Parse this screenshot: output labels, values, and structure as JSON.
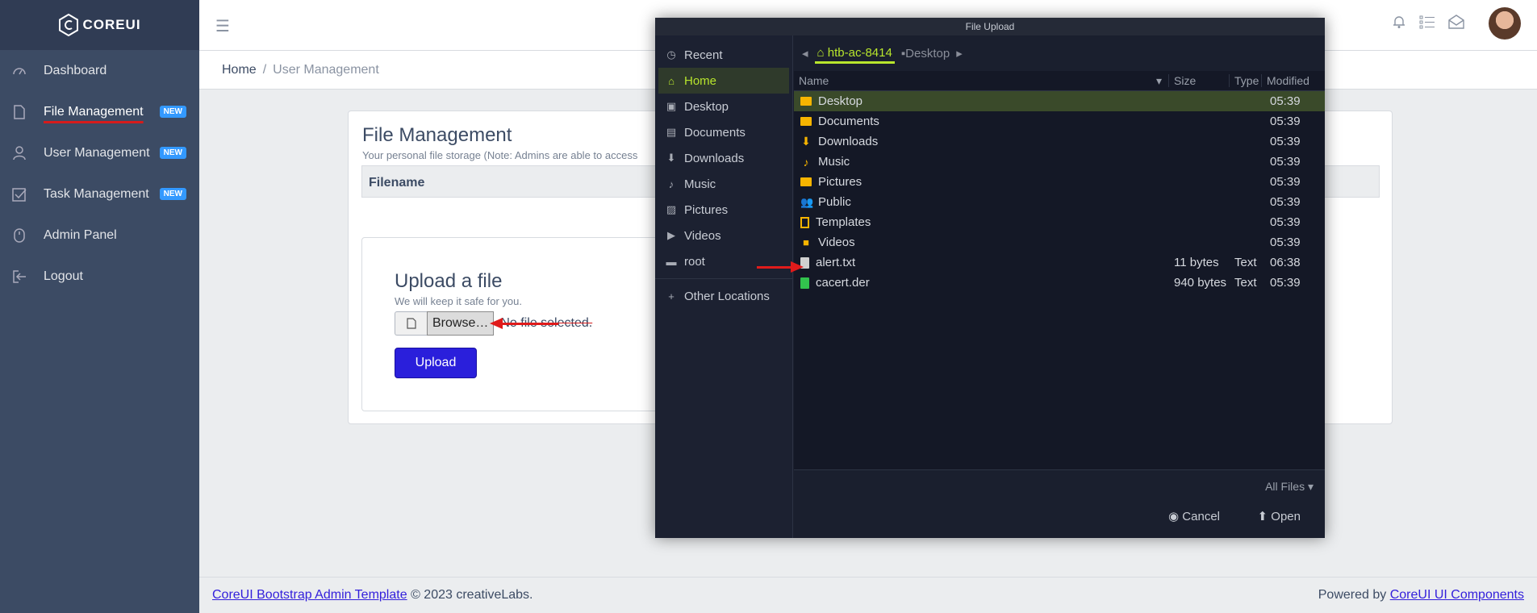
{
  "brand": {
    "name": "COREUI"
  },
  "sidebar": {
    "items": [
      {
        "label": "Dashboard",
        "icon": "speedometer-icon"
      },
      {
        "label": "File Management",
        "badge": "NEW",
        "icon": "file-icon"
      },
      {
        "label": "User Management",
        "badge": "NEW",
        "icon": "user-icon"
      },
      {
        "label": "Task Management",
        "badge": "NEW",
        "icon": "task-icon"
      },
      {
        "label": "Admin Panel",
        "icon": "mouse-icon"
      },
      {
        "label": "Logout",
        "icon": "logout-icon"
      }
    ]
  },
  "breadcrumb": {
    "home": "Home",
    "sep": "/",
    "current": "User Management"
  },
  "card": {
    "title": "File Management",
    "subtitle": "Your personal file storage (Note: Admins are able to access",
    "table_header": "Filename",
    "upload_title": "Upload a file",
    "upload_sub": "We will keep it safe for you.",
    "browse_label": "Browse…",
    "no_file": "No file selected.",
    "upload_button": "Upload"
  },
  "footer": {
    "left_link": "CoreUI Bootstrap Admin Template",
    "left_text": "© 2023 creativeLabs.",
    "right_text": "Powered by",
    "right_link": "CoreUI UI Components"
  },
  "dialog": {
    "title": "File Upload",
    "places": [
      "Recent",
      "Home",
      "Desktop",
      "Documents",
      "Downloads",
      "Music",
      "Pictures",
      "Videos",
      "root"
    ],
    "other_locations": "Other Locations",
    "path": {
      "home": "htb-ac-8414",
      "current": "Desktop"
    },
    "columns": {
      "name": "Name",
      "size": "Size",
      "type": "Type",
      "modified": "Modified"
    },
    "files": [
      {
        "name": "Desktop",
        "size": "",
        "type": "",
        "modified": "05:39"
      },
      {
        "name": "Documents",
        "size": "",
        "type": "",
        "modified": "05:39"
      },
      {
        "name": "Downloads",
        "size": "",
        "type": "",
        "modified": "05:39"
      },
      {
        "name": "Music",
        "size": "",
        "type": "",
        "modified": "05:39"
      },
      {
        "name": "Pictures",
        "size": "",
        "type": "",
        "modified": "05:39"
      },
      {
        "name": "Public",
        "size": "",
        "type": "",
        "modified": "05:39"
      },
      {
        "name": "Templates",
        "size": "",
        "type": "",
        "modified": "05:39"
      },
      {
        "name": "Videos",
        "size": "",
        "type": "",
        "modified": "05:39"
      },
      {
        "name": "alert.txt",
        "size": "11 bytes",
        "type": "Text",
        "modified": "06:38"
      },
      {
        "name": "cacert.der",
        "size": "940 bytes",
        "type": "Text",
        "modified": "05:39"
      }
    ],
    "filter": "All Files",
    "cancel": "Cancel",
    "open": "Open"
  }
}
